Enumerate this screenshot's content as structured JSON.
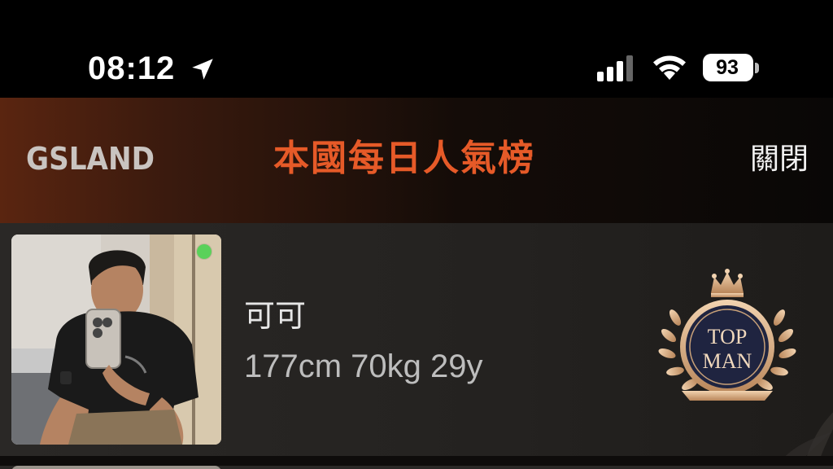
{
  "status_bar": {
    "time": "08:12",
    "battery": "93",
    "icons": [
      "location-arrow-icon",
      "cellular-signal-icon",
      "wifi-icon",
      "battery-icon"
    ]
  },
  "header": {
    "brand": "GSLAND",
    "title": "本國每日人氣榜",
    "close_label": "關閉"
  },
  "colors": {
    "title_accent": "#e65a28",
    "online": "#5ad15a",
    "badge_gold": "#d9b48a",
    "badge_navy": "#1f2440"
  },
  "ranking": {
    "items": [
      {
        "name": "可可",
        "stats": "177cm 70kg 29y",
        "online": true,
        "badge": {
          "line1": "TOP",
          "line2": "MAN"
        }
      }
    ]
  }
}
